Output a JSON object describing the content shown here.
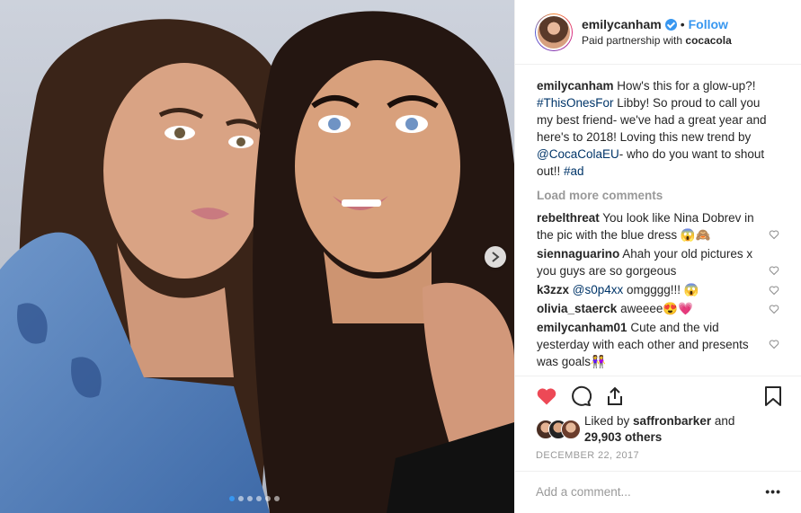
{
  "header": {
    "username": "emilycanham",
    "bullet": "•",
    "follow_label": "Follow",
    "subtitle_prefix": "Paid partnership with ",
    "partner": "cocacola"
  },
  "caption": {
    "username": "emilycanham",
    "text_1": " How's this for a glow-up?! ",
    "hashtag_1": "#ThisOnesFor",
    "text_2": " Libby! So proud to call you my best friend- we've had a great year and here's to 2018! Loving this new trend by ",
    "mention": "@CocaColaEU",
    "text_3": "- who do you want to shout out!! ",
    "hashtag_2": "#ad"
  },
  "load_more": "Load more comments",
  "comments": [
    {
      "user": "rebelthreat",
      "text": " You look like Nina Dobrev in the pic with the blue dress 😱🙈"
    },
    {
      "user": "siennaguarino",
      "text": " Ahah your old pictures x you guys are so gorgeous"
    },
    {
      "user": "k3zzx",
      "mention": " @s0p4xx",
      "text": " omgggg!!! 😱"
    },
    {
      "user": "olivia_staerck",
      "text": " aweeee😍💗"
    },
    {
      "user": "emilycanham01",
      "text": " Cute and the vid yesterday with each other and presents was goals👭"
    }
  ],
  "likes": {
    "prefix": "Liked by ",
    "user": "saffronbarker",
    "middle": " and",
    "count": "29,903 others"
  },
  "date": "DECEMBER 22, 2017",
  "add_comment_placeholder": "Add a comment...",
  "more_label": "•••",
  "carousel": {
    "total": 6,
    "active": 0
  },
  "colors": {
    "accent": "#3897f0",
    "like_red": "#ed4956",
    "text": "#262626",
    "muted": "#999999"
  }
}
